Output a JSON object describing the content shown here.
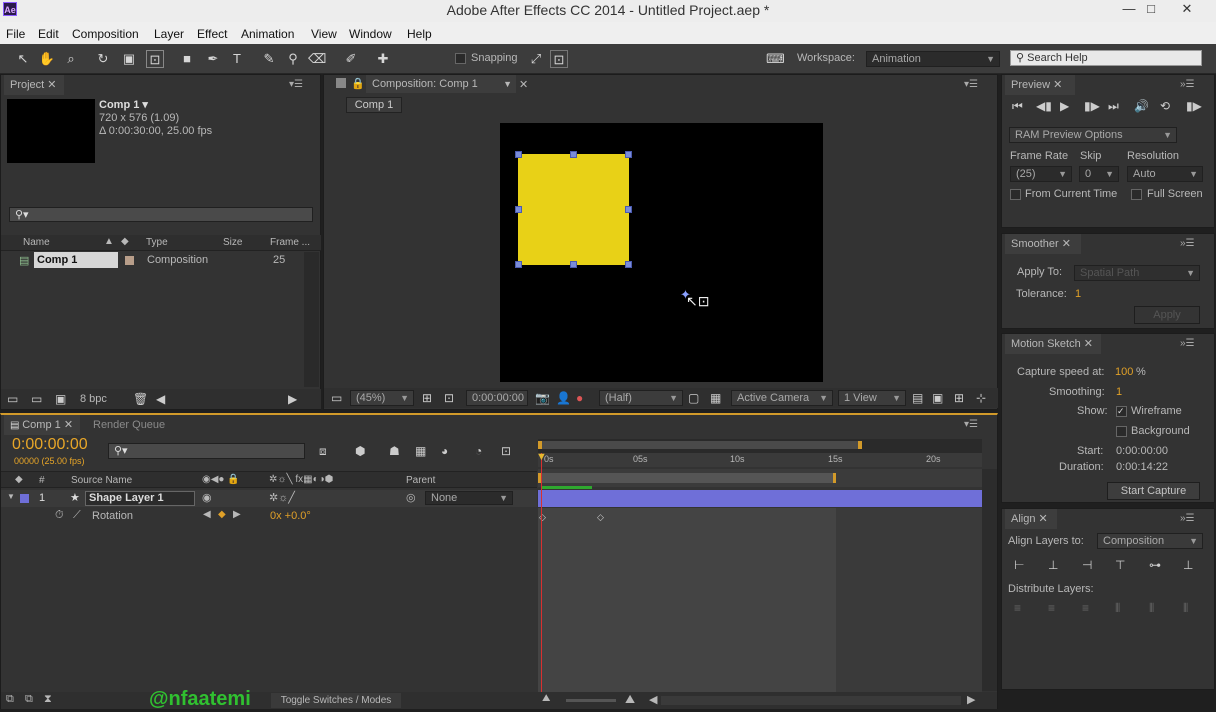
{
  "window": {
    "title": "Adobe After Effects CC 2014 - Untitled Project.aep *",
    "logo": "Ae",
    "minimize": "—",
    "maximize": "□",
    "close": "✕"
  },
  "menu": [
    "File",
    "Edit",
    "Composition",
    "Layer",
    "Effect",
    "Animation",
    "View",
    "Window",
    "Help"
  ],
  "toolbar": {
    "snapping": "Snapping",
    "workspace_label": "Workspace:",
    "workspace_value": "Animation",
    "search_placeholder": "Search Help"
  },
  "project": {
    "tab": "Project",
    "item_name": "Comp 1 ▾",
    "item_size": "720 x 576 (1.09)",
    "item_duration": "Δ 0:00:30:00, 25.00 fps",
    "search_icon": "⚲▾",
    "columns": {
      "name": "Name",
      "type": "Type",
      "size": "Size",
      "frame": "Frame ..."
    },
    "rows": [
      {
        "name": "Comp 1",
        "type": "Composition",
        "frame": "25"
      }
    ],
    "bpc": "8 bpc"
  },
  "composition": {
    "tab": "Composition: Comp 1",
    "breadcrumb": "Comp 1",
    "zoom": "(45%)",
    "timecode": "0:00:00:00",
    "resolution": "(Half)",
    "camera": "Active Camera",
    "view": "1 View",
    "solid_color": "#e8d117"
  },
  "preview": {
    "tab": "Preview",
    "ram_options": "RAM Preview Options",
    "frame_rate_label": "Frame Rate",
    "skip_label": "Skip",
    "resolution_label": "Resolution",
    "frame_rate": "(25)",
    "skip": "0",
    "resolution": "Auto",
    "from_current": "From Current Time",
    "full_screen": "Full Screen"
  },
  "smoother": {
    "tab": "Smoother",
    "apply_to_label": "Apply To:",
    "apply_to_value": "Spatial Path",
    "tolerance_label": "Tolerance:",
    "tolerance_value": "1",
    "apply_button": "Apply"
  },
  "motion_sketch": {
    "tab": "Motion Sketch",
    "capture_speed_label": "Capture speed at:",
    "capture_speed_value": "100",
    "percent": "%",
    "smoothing_label": "Smoothing:",
    "smoothing_value": "1",
    "show_label": "Show:",
    "wireframe": "Wireframe",
    "background": "Background",
    "start_label": "Start:",
    "start_value": "0:00:00:00",
    "duration_label": "Duration:",
    "duration_value": "0:00:14:22",
    "capture_button": "Start Capture"
  },
  "align": {
    "tab": "Align",
    "align_to_label": "Align Layers to:",
    "align_to_value": "Composition",
    "distribute_label": "Distribute Layers:"
  },
  "timeline": {
    "tab_comp": "Comp 1",
    "tab_render": "Render Queue",
    "timecode": "0:00:00:00",
    "frame_info": "00000 (25.00 fps)",
    "search_icon": "⚲▾",
    "col_hash": "#",
    "col_source": "Source Name",
    "col_parent": "Parent",
    "layer_index": "1",
    "layer_name": "Shape Layer 1",
    "parent_value": "None",
    "property_name": "Rotation",
    "property_value": "0x +0.0°",
    "ruler": [
      "0s",
      "05s",
      "10s",
      "15s",
      "20s"
    ],
    "toggle_modes": "Toggle Switches / Modes",
    "layer_color": "#6f6fd8",
    "watermark": "@nfaatemi"
  }
}
